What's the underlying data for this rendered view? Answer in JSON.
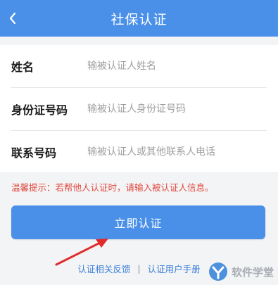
{
  "header": {
    "title": "社保认证",
    "back_icon": "chevron-left-icon"
  },
  "form": {
    "fields": [
      {
        "label": "姓名",
        "placeholder": "输被认证人姓名",
        "value": ""
      },
      {
        "label": "身份证号码",
        "placeholder": "输被认证人身份证号码",
        "value": ""
      },
      {
        "label": "联系号码",
        "placeholder": "输被认证人或其他联系人电话",
        "value": ""
      }
    ]
  },
  "tip": "温馨提示：若帮他人认证时，请输入被认证人信息。",
  "submit_label": "立即认证",
  "links": {
    "feedback": "认证相关反馈",
    "separator": "|",
    "manual": "认证用户手册"
  },
  "watermark": {
    "text": "软件学堂"
  },
  "colors": {
    "primary": "#4a90e8",
    "tip": "#e2483c",
    "link": "#3b7fd6",
    "arrow": "#e02b2b"
  }
}
